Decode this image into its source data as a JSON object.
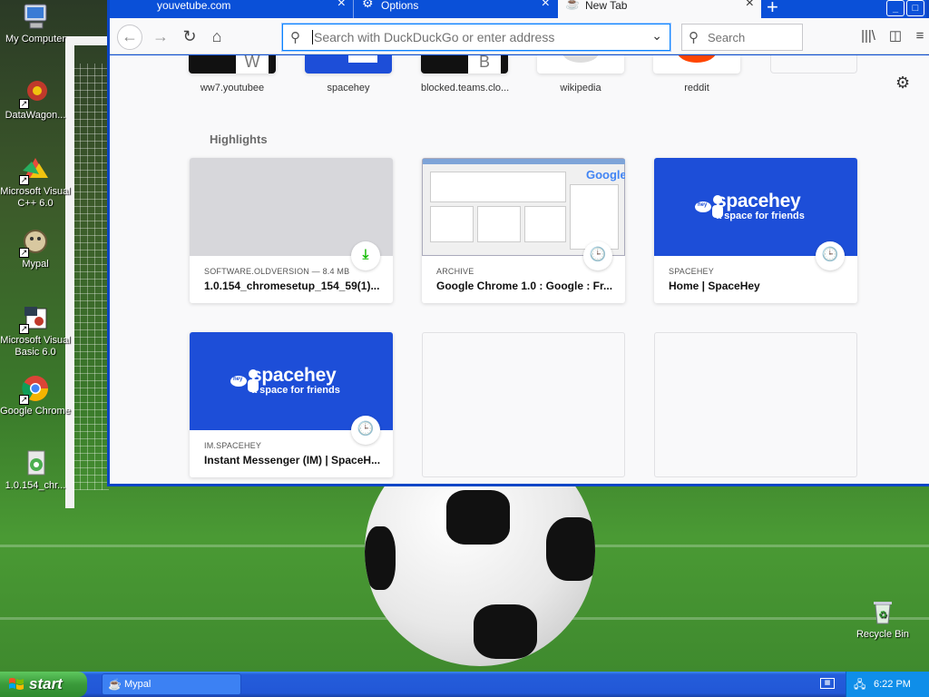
{
  "desktop": {
    "icons": [
      {
        "label": "My Computer"
      },
      {
        "label": "DataWagon..."
      },
      {
        "label": "Microsoft Visual C++ 6.0"
      },
      {
        "label": "Mypal"
      },
      {
        "label": "Microsoft Visual Basic 6.0"
      },
      {
        "label": "Google Chrome"
      },
      {
        "label": "1.0.154_chr..."
      },
      {
        "label": "Recycle Bin"
      }
    ]
  },
  "browser": {
    "tabs": [
      {
        "title": "youvetube.com"
      },
      {
        "title": "Options"
      },
      {
        "title": "New Tab"
      }
    ],
    "address_placeholder": "Search with DuckDuckGo or enter address",
    "search_placeholder": "Search",
    "top_sites": [
      {
        "label": "ww7.youtubee",
        "letter": "W"
      },
      {
        "label": "spacehey",
        "letter": ""
      },
      {
        "label": "blocked.teams.clo...",
        "letter": "B"
      },
      {
        "label": "wikipedia",
        "letter": ""
      },
      {
        "label": "reddit",
        "letter": ""
      }
    ],
    "highlights_title": "Highlights",
    "highlights": [
      {
        "source": "SOFTWARE.OLDVERSION — 8.4 MB",
        "title": "1.0.154_chromesetup_154_59(1)..."
      },
      {
        "source": "ARCHIVE",
        "title": "Google Chrome 1.0 : Google : Fr...",
        "logo": "Google"
      },
      {
        "source": "SPACEHEY",
        "title": "Home | SpaceHey",
        "brand": "spacehey",
        "tagline": "a space for friends",
        "hey": "hey"
      },
      {
        "source": "IM.SPACEHEY",
        "title": "Instant Messenger (IM) | SpaceH...",
        "brand": "spacehey",
        "tagline": "a space for friends",
        "hey": "hey"
      }
    ]
  },
  "taskbar": {
    "start_label": "start",
    "task_label": "Mypal",
    "clock": "6:22 PM"
  },
  "colors": {
    "xp_blue": "#0a50d8",
    "spacehey_blue": "#1d4ed8",
    "download_green": "#12bc00"
  }
}
